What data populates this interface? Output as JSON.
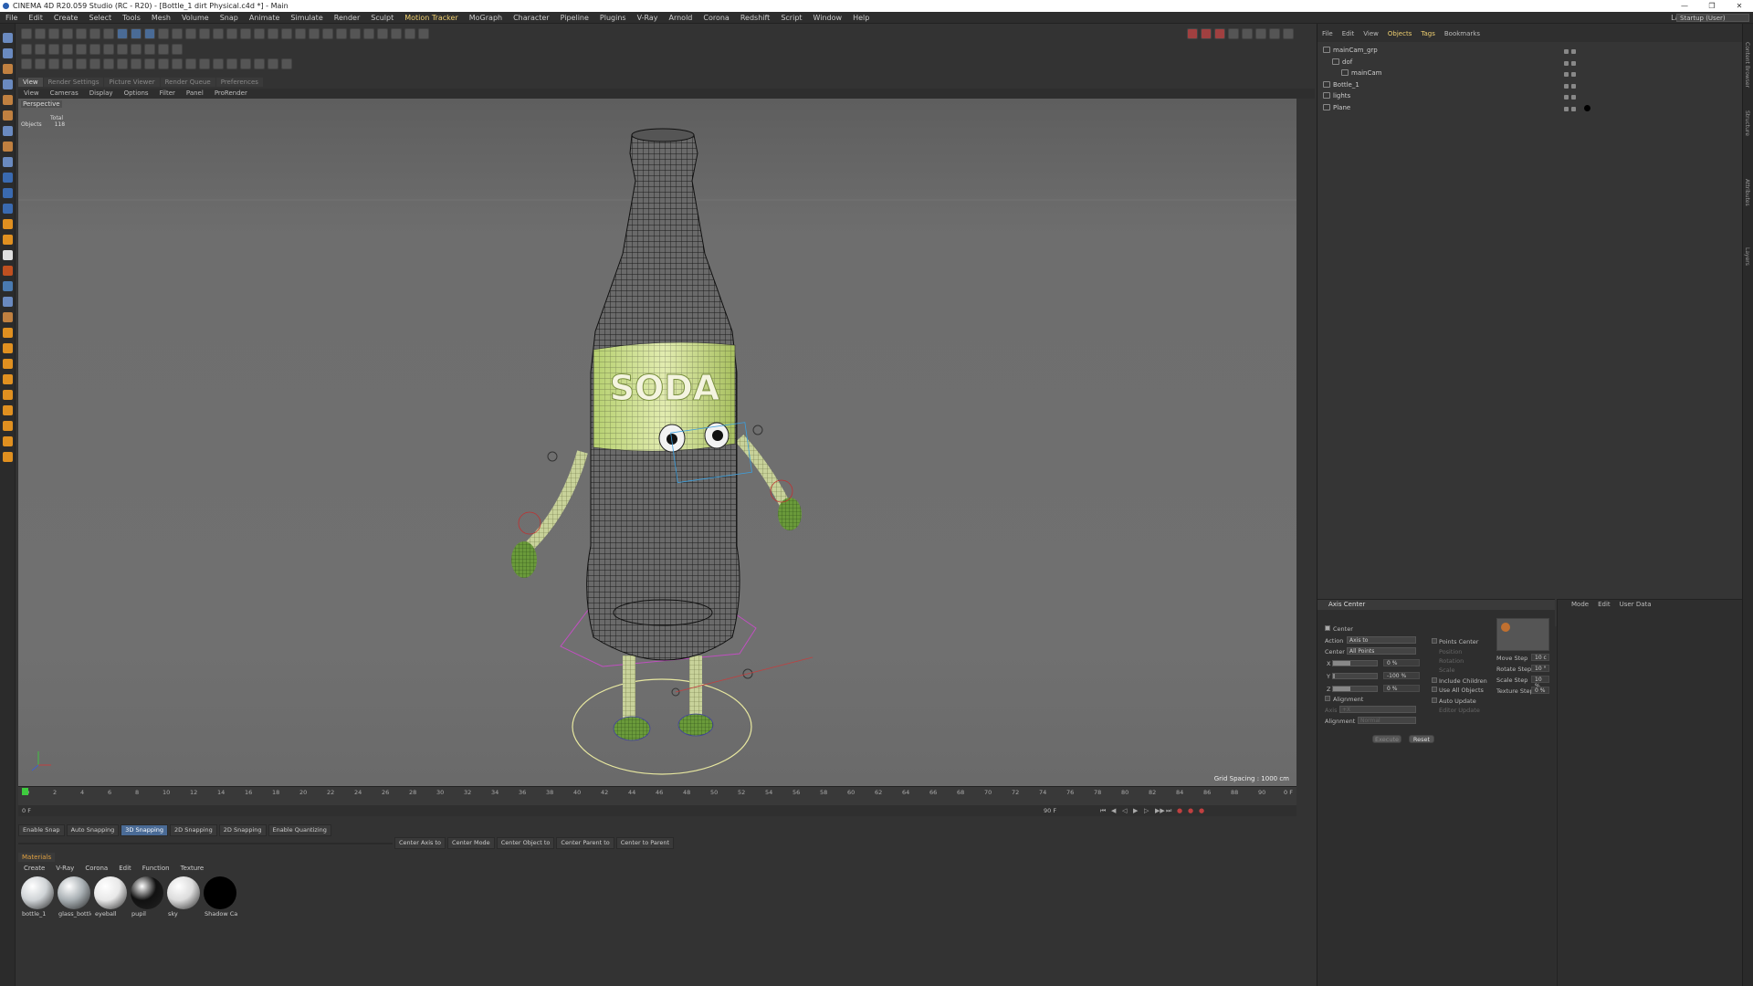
{
  "window": {
    "title": "CINEMA 4D R20.059 Studio (RC - R20) - [Bottle_1 dirt  Physical.c4d *] - Main",
    "controls": [
      "—",
      "❐",
      "✕"
    ]
  },
  "menubar": {
    "items": [
      "File",
      "Edit",
      "Create",
      "Select",
      "Tools",
      "Mesh",
      "Volume",
      "Snap",
      "Animate",
      "Simulate",
      "Render",
      "Sculpt",
      "Motion Tracker",
      "MoGraph",
      "Character",
      "Pipeline",
      "Plugins",
      "V-Ray",
      "Arnold",
      "Corona",
      "Redshift",
      "Script",
      "Window",
      "Help"
    ],
    "highlighted": "Motion Tracker",
    "layout_label": "Layout:",
    "layout_value": "Startup (User)"
  },
  "view_tabs": [
    "View",
    "Render Settings",
    "Picture Viewer",
    "Render Queue",
    "Preferences"
  ],
  "view_menu": [
    "View",
    "Cameras",
    "Display",
    "Options",
    "Filter",
    "Panel",
    "ProRender"
  ],
  "viewport": {
    "camera": "Perspective",
    "stats_header": "Total",
    "stats_label": "Objects",
    "stats_value": "118",
    "grid_spacing": "Grid Spacing : 1000 cm",
    "label_text": "SODA"
  },
  "timeline": {
    "ticks": [
      "0",
      "2",
      "4",
      "6",
      "8",
      "10",
      "12",
      "14",
      "16",
      "18",
      "20",
      "22",
      "24",
      "26",
      "28",
      "30",
      "32",
      "34",
      "36",
      "38",
      "40",
      "42",
      "44",
      "46",
      "48",
      "50",
      "52",
      "54",
      "56",
      "58",
      "60",
      "62",
      "64",
      "66",
      "68",
      "70",
      "72",
      "74",
      "76",
      "78",
      "80",
      "82",
      "84",
      "86",
      "88",
      "90"
    ],
    "current_frame": "0 F",
    "end_frame": "90 F",
    "start_field": "0 F"
  },
  "snapping": {
    "items": [
      "Enable Snap",
      "Auto Snapping",
      "3D Snapping",
      "2D Snapping",
      "2D Snapping",
      "Enable Quantizing"
    ],
    "active": "3D Snapping"
  },
  "axis_tools": [
    "Center Axis to",
    "Center Mode",
    "Center Object to",
    "Center Parent to",
    "Center to Parent"
  ],
  "materials": {
    "tab": "Materials",
    "menu": [
      "Create",
      "V-Ray",
      "Corona",
      "Edit",
      "Function",
      "Texture"
    ],
    "items": [
      {
        "name": "bottle_1",
        "color": "#cfd3d6"
      },
      {
        "name": "glass_bottle",
        "color": "#a9b0b4"
      },
      {
        "name": "eyeball",
        "color": "#e8e8e8"
      },
      {
        "name": "pupil",
        "color": "#111111"
      },
      {
        "name": "sky",
        "color": "#dcdcdc"
      },
      {
        "name": "Shadow Ca",
        "color": "#000000"
      }
    ]
  },
  "object_manager": {
    "menu": [
      "File",
      "Edit",
      "View",
      "Objects",
      "Tags",
      "Bookmarks"
    ],
    "highlighted": [
      "Objects",
      "Tags"
    ],
    "objects": [
      {
        "name": "mainCam_grp",
        "level": 0
      },
      {
        "name": "dof",
        "level": 1
      },
      {
        "name": "mainCam",
        "level": 2
      },
      {
        "name": "Bottle_1",
        "level": 0
      },
      {
        "name": "lights",
        "level": 0
      },
      {
        "name": "Plane",
        "level": 0
      }
    ]
  },
  "attributes": {
    "title": "Axis Center",
    "center_label": "Center",
    "action_label": "Action",
    "action_value": "Axis to",
    "center_mode_label": "Center",
    "center_mode_value": "All Points",
    "x_label": "X",
    "x_value": "0 %",
    "y_label": "Y",
    "y_value": "-100 %",
    "z_label": "Z",
    "z_value": "0 %",
    "points_center": "Points Center",
    "position": "Position",
    "rotation": "Rotation",
    "scale": "Scale",
    "include_children": "Include Children",
    "use_all_objects": "Use All Objects",
    "auto_update": "Auto Update",
    "editor_update": "Editor Update",
    "alignment_header": "Alignment",
    "axis_label": "Axis",
    "axis_value": "+X",
    "alignment_label": "Alignment",
    "alignment_value": "Normal",
    "execute": "Execute",
    "reset": "Reset",
    "move_step_label": "Move Step",
    "move_step": "10 c",
    "rotate_step_label": "Rotate Step",
    "rotate_step": "10 °",
    "scale_step_label": "Scale Step",
    "scale_step": "10 %",
    "texture_step_label": "Texture Step",
    "texture_step": "0 %"
  },
  "attr_right_menu": [
    "Mode",
    "Edit",
    "User Data"
  ],
  "side_strip": [
    "Content Browser",
    "Structure",
    "Attributes",
    "Layers"
  ]
}
